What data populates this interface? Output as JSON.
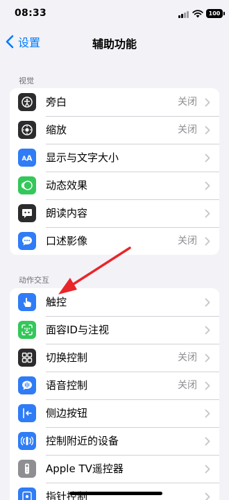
{
  "status_bar": {
    "time": "08:33",
    "battery": "100"
  },
  "nav": {
    "back_label": "设置",
    "title": "辅助功能"
  },
  "sections": [
    {
      "header": "视觉",
      "rows": [
        {
          "label": "旁白",
          "value": "关闭",
          "icon": "voiceover-icon",
          "color": "#2c2c2e"
        },
        {
          "label": "缩放",
          "value": "关闭",
          "icon": "zoom-icon",
          "color": "#2c2c2e"
        },
        {
          "label": "显示与文字大小",
          "value": "",
          "icon": "text-size-icon",
          "color": "#2f7cf6"
        },
        {
          "label": "动态效果",
          "value": "",
          "icon": "motion-icon",
          "color": "#34c759"
        },
        {
          "label": "朗读内容",
          "value": "",
          "icon": "spoken-content-icon",
          "color": "#2c2c2e"
        },
        {
          "label": "口述影像",
          "value": "关闭",
          "icon": "audio-description-icon",
          "color": "#2f7cf6"
        }
      ]
    },
    {
      "header": "动作交互",
      "rows": [
        {
          "label": "触控",
          "value": "",
          "icon": "touch-icon",
          "color": "#2f7cf6"
        },
        {
          "label": "面容ID与注视",
          "value": "",
          "icon": "face-id-icon",
          "color": "#34c759"
        },
        {
          "label": "切换控制",
          "value": "关闭",
          "icon": "switch-control-icon",
          "color": "#2c2c2e"
        },
        {
          "label": "语音控制",
          "value": "关闭",
          "icon": "voice-control-icon",
          "color": "#2f7cf6"
        },
        {
          "label": "侧边按钮",
          "value": "",
          "icon": "side-button-icon",
          "color": "#2f7cf6"
        },
        {
          "label": "控制附近的设备",
          "value": "",
          "icon": "nearby-devices-icon",
          "color": "#2f7cf6"
        },
        {
          "label": "Apple TV遥控器",
          "value": "",
          "icon": "apple-tv-remote-icon",
          "color": "#8e8e93"
        },
        {
          "label": "指针控制",
          "value": "",
          "icon": "pointer-control-icon",
          "color": "#2f7cf6"
        }
      ]
    }
  ],
  "colors": {
    "accent": "#007aff",
    "annotation_arrow": "#e8262a"
  }
}
